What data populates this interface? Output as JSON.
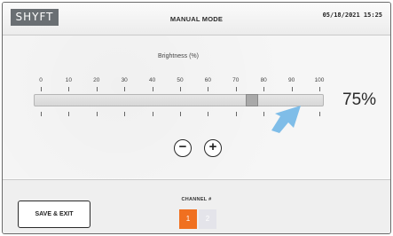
{
  "header": {
    "logo": "SHYFT",
    "title": "MANUAL MODE",
    "datetime": "05/18/2021  15:25"
  },
  "brightness": {
    "label": "Brightness (%)",
    "scale": [
      "0",
      "10",
      "20",
      "30",
      "40",
      "50",
      "60",
      "70",
      "80",
      "90",
      "100"
    ],
    "value": 75,
    "value_text": "75%"
  },
  "controls": {
    "decrease_symbol": "−",
    "increase_symbol": "+"
  },
  "footer": {
    "save_exit_label": "SAVE & EXIT",
    "channel_label": "CHANNEL #",
    "channels": [
      {
        "label": "1",
        "selected": true
      },
      {
        "label": "2",
        "selected": false
      }
    ]
  },
  "colors": {
    "channel_active": "#f07020",
    "channel_inactive": "#e4e4ea",
    "pointer_arrow": "#7fbde8"
  },
  "icons": {
    "decrease": "minus-circle-icon",
    "increase": "plus-circle-icon",
    "annotation": "arrow-pointer-icon"
  }
}
